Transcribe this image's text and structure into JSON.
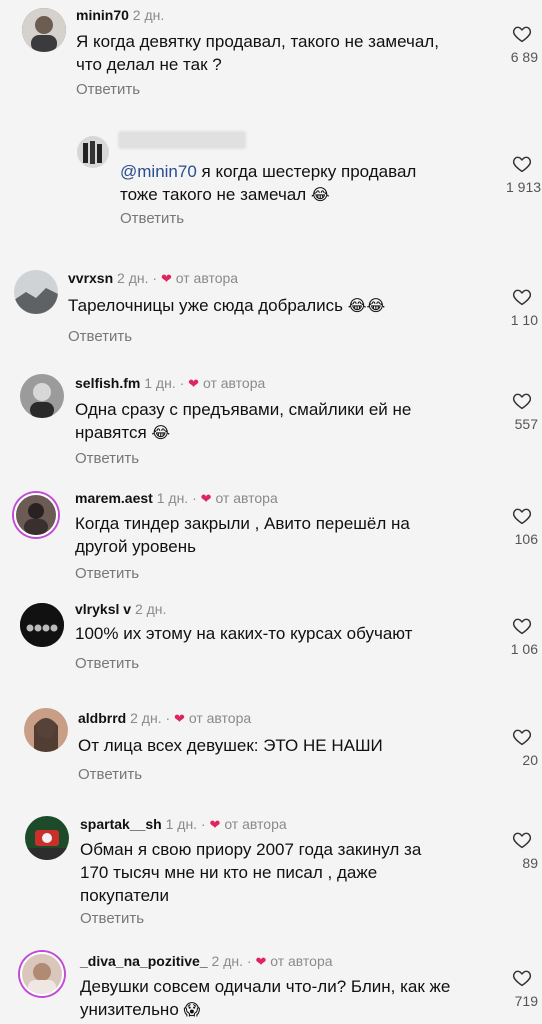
{
  "comments": [
    {
      "user": "minin70",
      "time": "2 дн.",
      "text1": "Я когда девятку продавал, такого не замечал,",
      "text2": "что делал не так ?",
      "reply": "Ответить",
      "likes": "6 89",
      "author_badge": ""
    },
    {
      "user": "",
      "time": "",
      "mention": "@minin70",
      "text1": " я когда шестерку продавал",
      "text2": "тоже такого не замечал",
      "emoji": "😂",
      "reply": "Ответить",
      "likes": "1 913"
    },
    {
      "user": "vvrxsn",
      "time": "2 дн.",
      "author_badge": "от автора",
      "text1": "Тарелочницы уже сюда добрались",
      "emoji": "😂😂",
      "reply": "Ответить",
      "likes": "1 10"
    },
    {
      "user": "selfish.fm",
      "time": "1 дн.",
      "author_badge": "от автора",
      "text1": "Одна сразу с предъявами, смайлики ей не",
      "text2": "нравятся",
      "emoji": "😂",
      "reply": "Ответить",
      "likes": "557"
    },
    {
      "user": "marem.aest",
      "time": "1 дн.",
      "author_badge": "от автора",
      "text1": "Когда тиндер закрыли , Авито перешёл на",
      "text2": "другой уровень",
      "reply": "Ответить",
      "likes": "106"
    },
    {
      "user": "vlryksl v",
      "time": "2 дн.",
      "text1": "100% их этому на каких-то курсах обучают",
      "reply": "Ответить",
      "likes": "1 06"
    },
    {
      "user": "aldbrrd",
      "time": "2 дн.",
      "author_badge": "от автора",
      "text1": "От лица всех девушек: ЭТО НЕ НАШИ",
      "reply": "Ответить",
      "likes": "20"
    },
    {
      "user": "spartak__sh",
      "time": "1 дн.",
      "author_badge": "от автора",
      "text1": "Обман я свою приору 2007 года закинул за",
      "text2": "170 тысяч мне ни кто не писал , даже",
      "text3": "покупатели",
      "reply": "Ответить",
      "likes": "89"
    },
    {
      "user": "_diva_na_pozitive_",
      "time": "2 дн.",
      "author_badge": "от автора",
      "text1": "Девушки совсем одичали что-ли? Блин, как же",
      "text2": "унизительно",
      "emoji": "😱",
      "reply": "",
      "likes": "719"
    }
  ],
  "icons": {
    "heart": "heart-icon",
    "author_heart": "heart-filled-icon"
  },
  "colors": {
    "accent_heart": "#e0245e",
    "muted": "#8a8a8a",
    "story_ring": "#c24bd6"
  }
}
